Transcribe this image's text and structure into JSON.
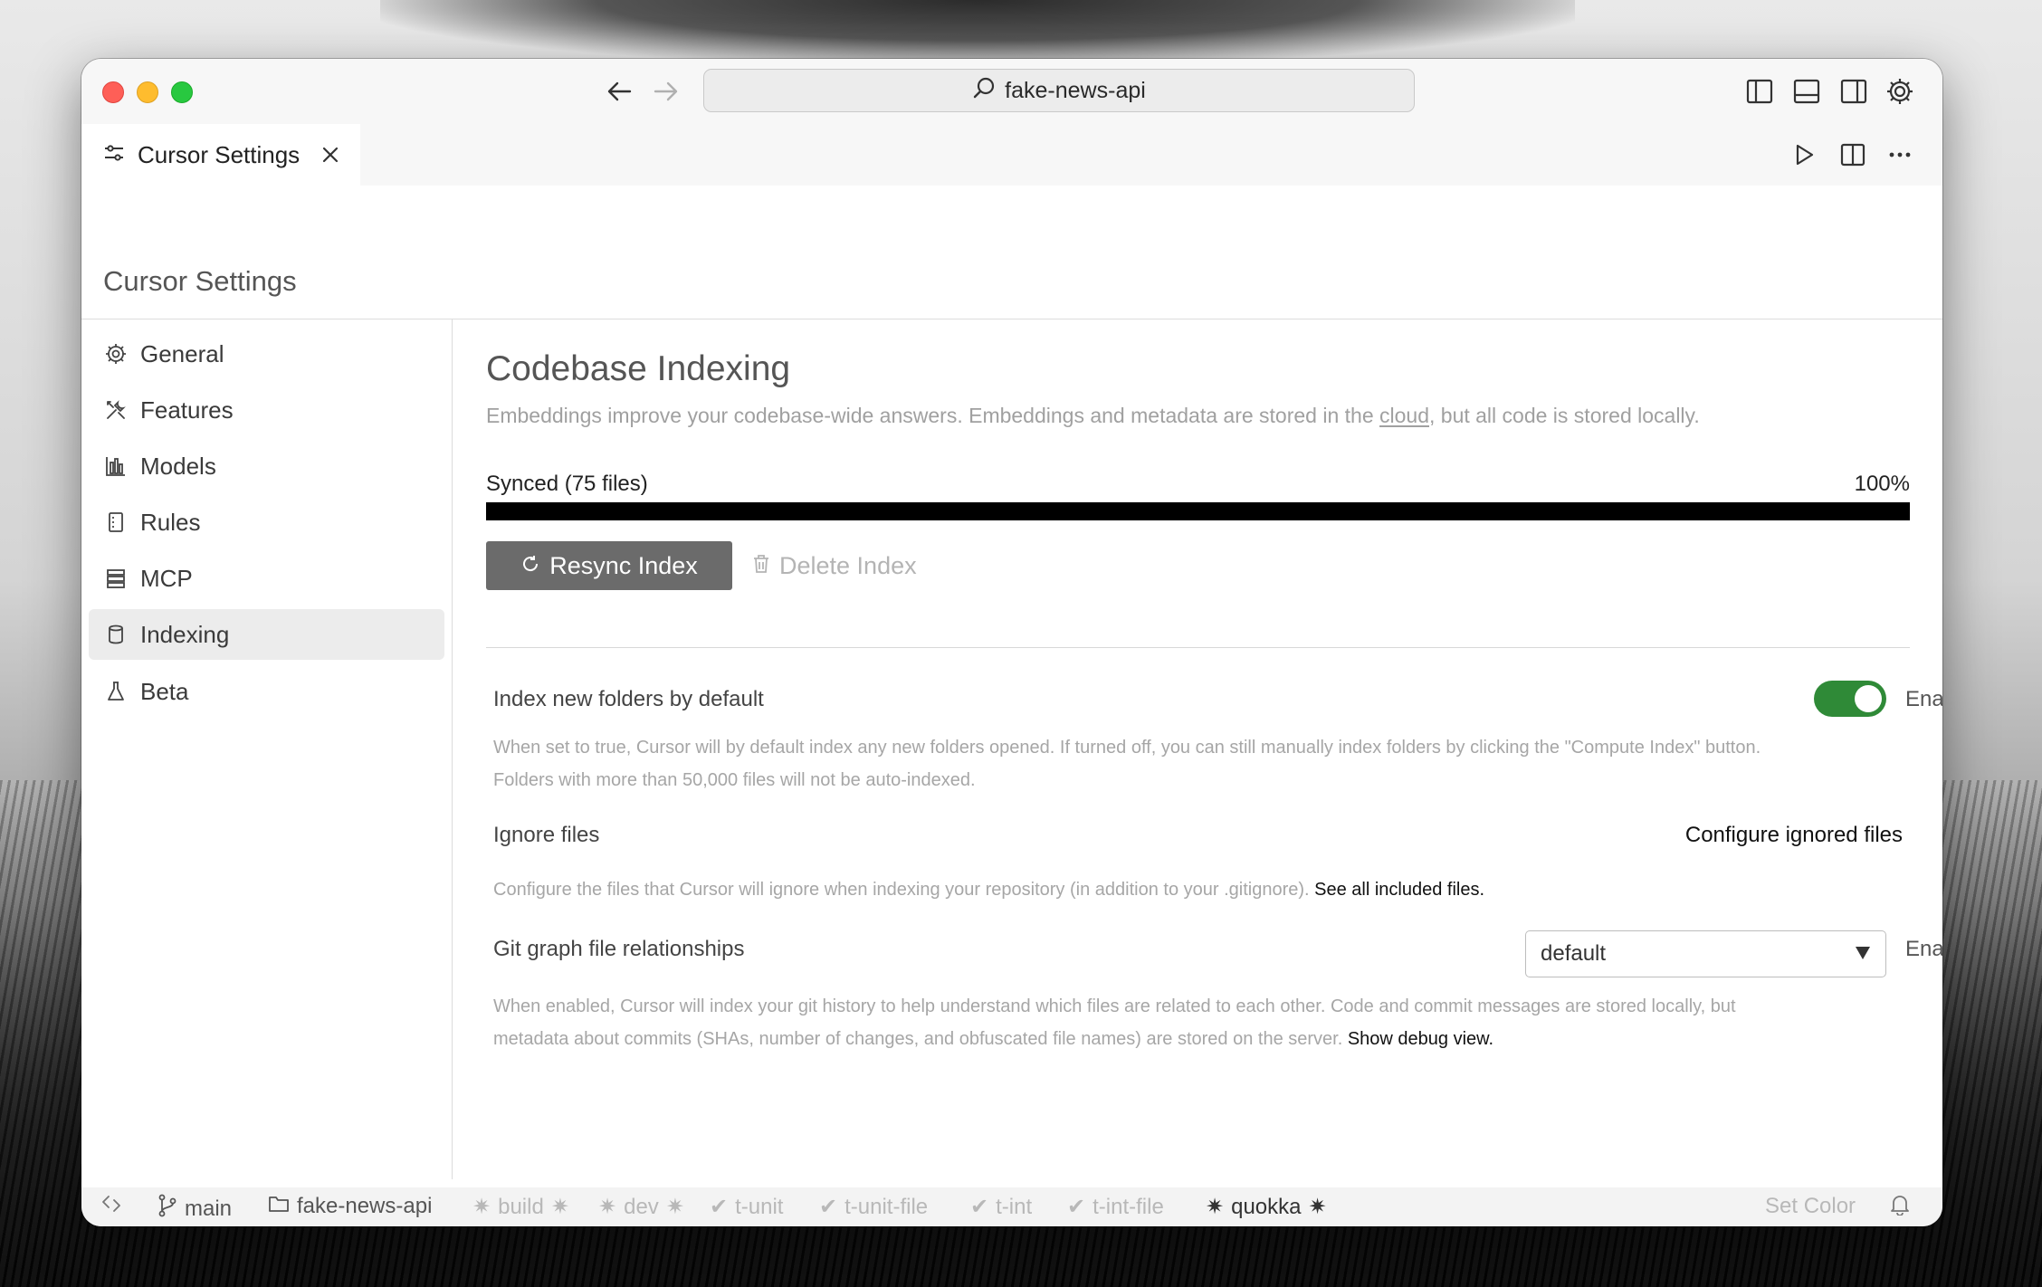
{
  "search": {
    "text": "fake-news-api"
  },
  "tab": {
    "label": "Cursor Settings"
  },
  "header": {
    "title": "Cursor Settings"
  },
  "sidebar": {
    "items": [
      {
        "label": "General",
        "icon": "gear-icon"
      },
      {
        "label": "Features",
        "icon": "tools-icon"
      },
      {
        "label": "Models",
        "icon": "models-icon"
      },
      {
        "label": "Rules",
        "icon": "rules-icon"
      },
      {
        "label": "MCP",
        "icon": "server-icon"
      },
      {
        "label": "Indexing",
        "icon": "database-icon",
        "active": true
      },
      {
        "label": "Beta",
        "icon": "flask-icon"
      }
    ]
  },
  "main": {
    "title": "Codebase Indexing",
    "description_before": "Embeddings improve your codebase-wide answers. Embeddings and metadata are stored in the ",
    "description_link": "cloud",
    "description_after": ", but all code is stored locally.",
    "synced_label": "Synced (75 files)",
    "progress_text": "100%",
    "progress_value": 1.0,
    "resync_label": "Resync Index",
    "delete_label": "Delete Index",
    "index_new_folders": {
      "label": "Index new folders by default",
      "toggle_state": "on",
      "status": "Enabled",
      "description_line1": "When set to true, Cursor will by default index any new folders opened. If turned off, you can still manually index folders by clicking the \"Compute Index\" button.",
      "description_line2": "Folders with more than 50,000 files will not be auto-indexed."
    },
    "ignore_files": {
      "label": "Ignore files",
      "action": "Configure ignored files",
      "description": "Configure the files that Cursor will ignore when indexing your repository (in addition to your .gitignore). ",
      "link": "See all included files."
    },
    "git_graph": {
      "label": "Git graph file relationships",
      "select_value": "default",
      "status": "Enabled",
      "description_line1": "When enabled, Cursor will index your git history to help understand which files are related to each other. Code and commit messages are stored locally, but",
      "description_line2": "metadata about commits (SHAs, number of changes, and obfuscated file names) are stored on the server. ",
      "link": "Show debug view."
    }
  },
  "statusbar": {
    "branch": "main",
    "folder": "fake-news-api",
    "tasks": [
      {
        "label": "build",
        "style": "star",
        "dim": true
      },
      {
        "label": "dev",
        "style": "star",
        "dim": true
      },
      {
        "label": "t-unit",
        "style": "check",
        "dim": true
      },
      {
        "label": "t-unit-file",
        "style": "check",
        "dim": true
      },
      {
        "label": "t-int",
        "style": "check",
        "dim": true
      },
      {
        "label": "t-int-file",
        "style": "check",
        "dim": true
      },
      {
        "label": "quokka",
        "style": "star",
        "dim": false
      }
    ],
    "set_color": "Set Color"
  },
  "colors": {
    "toggle_on": "#2f8a37",
    "progress": "#000000",
    "resync_button": "#6b6b6b"
  }
}
